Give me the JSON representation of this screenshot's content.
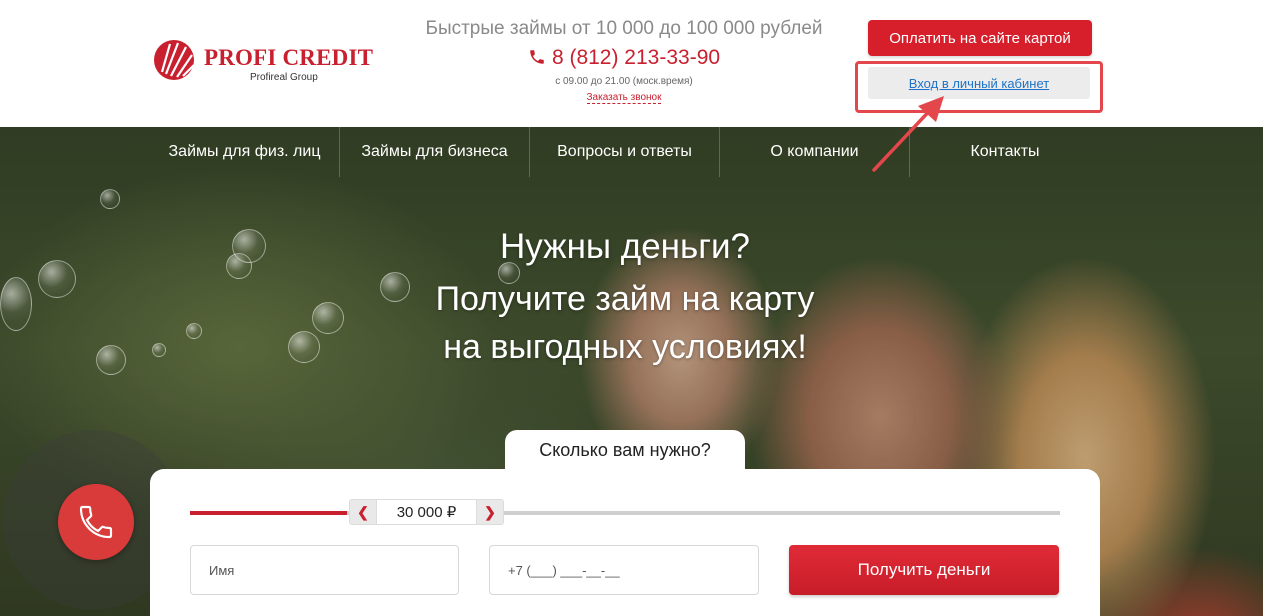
{
  "header": {
    "logo": {
      "name": "PROFI CREDIT",
      "sub": "Profireal Group"
    },
    "tagline": "Быстрые займы от 10 000 до 100 000 рублей",
    "phone": "8 (812) 213-33-90",
    "hours": "с 09.00 до 21.00 (моск.время)",
    "callback_label": "Заказать звонок",
    "pay_button": "Оплатить на сайте картой",
    "cabinet_link": "Вход в личный кабинет"
  },
  "nav": {
    "items": [
      {
        "label": "Займы для физ. лиц"
      },
      {
        "label": "Займы для бизнеса"
      },
      {
        "label": "Вопросы и ответы"
      },
      {
        "label": "О компании"
      },
      {
        "label": "Контакты"
      }
    ]
  },
  "hero": {
    "title": "Нужны деньги?",
    "subtitle_line1": "Получите займ на карту",
    "subtitle_line2": "на выгодных условиях!"
  },
  "form": {
    "tab_label": "Сколько вам нужно?",
    "amount": "30 000 ₽",
    "amount_fraction": 0.18,
    "name_placeholder": "Имя",
    "phone_placeholder": "+7 (___) ___-__-__",
    "submit_label": "Получить деньги"
  },
  "colors": {
    "brand": "#c8202f",
    "link": "#1e73c8",
    "highlight": "#e3474b"
  },
  "icons": {
    "logo": "shell-logo-icon",
    "phone": "phone-icon",
    "call": "phone-handset-icon",
    "prev": "chevron-left-icon",
    "next": "chevron-right-icon",
    "annotation": "arrow-icon"
  }
}
